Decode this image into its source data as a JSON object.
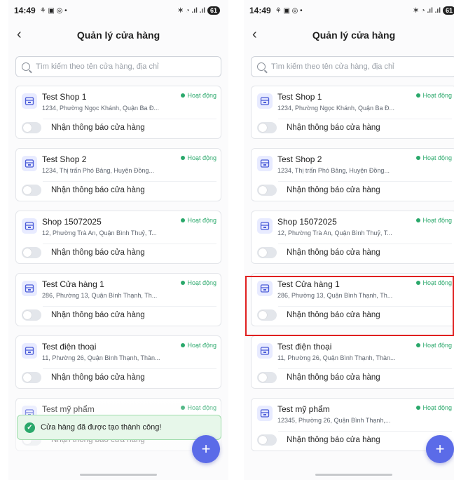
{
  "status_bar": {
    "time": "14:49",
    "left_icons": "⚘ ▣ ◎ •",
    "right_icons": "✶ ◔ .ıl .ıl",
    "battery": "61"
  },
  "header": {
    "title": "Quản lý cửa hàng",
    "back_icon": "‹"
  },
  "search": {
    "placeholder": "Tìm kiếm theo tên cửa hàng, địa chỉ"
  },
  "stores": [
    {
      "name": "Test Shop 1",
      "address": "1234, Phường Ngọc Khánh, Quận Ba Đ...",
      "status": "Hoạt động",
      "notify_label": "Nhận thông báo cửa hàng",
      "notify_on": false
    },
    {
      "name": "Test Shop 2",
      "address": "1234, Thị trấn Phó Bảng, Huyện Đồng...",
      "status": "Hoạt động",
      "notify_label": "Nhận thông báo cửa hàng",
      "notify_on": false
    },
    {
      "name": "Shop 15072025",
      "address": "12, Phường Trà An, Quận Bình Thuỷ, T...",
      "status": "Hoạt động",
      "notify_label": "Nhận thông báo cửa hàng",
      "notify_on": false
    },
    {
      "name": "Test Cửa hàng 1",
      "address": "286, Phường 13, Quận Bình Thạnh, Th...",
      "status": "Hoạt động",
      "notify_label": "Nhận thông báo cửa hàng",
      "notify_on": false
    },
    {
      "name": "Test điện thoại",
      "address": "11, Phường 26, Quận Bình Thạnh, Thàn...",
      "status": "Hoạt động",
      "notify_label": "Nhận thông báo cửa hàng",
      "notify_on": false
    },
    {
      "name": "Test mỹ phẩm",
      "address": "12345, Phường 26, Quận Bình Thạnh,...",
      "status": "Hoạt động",
      "notify_label": "Nhận thông báo cửa hàng",
      "notify_on": false
    }
  ],
  "toast": {
    "message": "Cửa hàng đã được tạo thành công!"
  },
  "fab": {
    "label": "+"
  },
  "colors": {
    "accent": "#5b6be8",
    "active": "#2aa86b",
    "highlight": "#e02020",
    "toast_bg": "#e7f7ea"
  }
}
